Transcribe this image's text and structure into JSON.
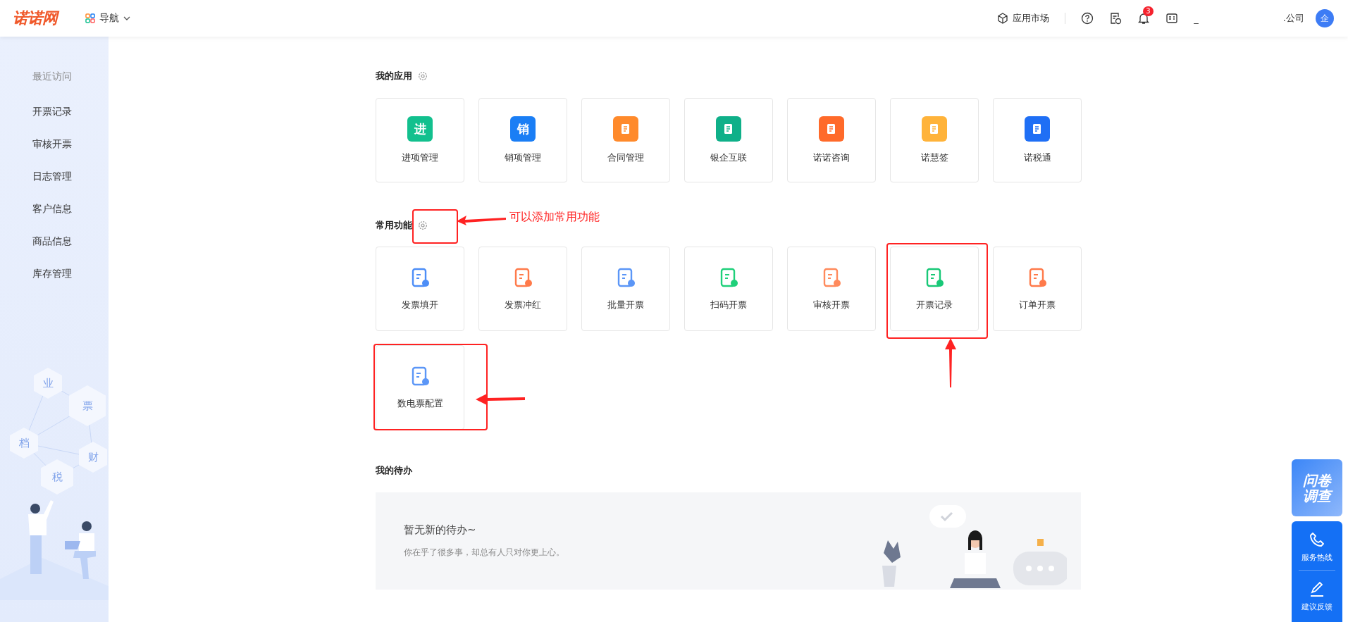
{
  "header": {
    "logo": "诺诺网",
    "nav": "导航",
    "market": "应用市场",
    "notifications": "3",
    "user": "_",
    "company": ".公司",
    "avatar": "企"
  },
  "sidebar": {
    "title": "最近访问",
    "items": [
      {
        "label": "开票记录"
      },
      {
        "label": "审核开票"
      },
      {
        "label": "日志管理"
      },
      {
        "label": "客户信息"
      },
      {
        "label": "商品信息"
      },
      {
        "label": "库存管理"
      }
    ],
    "hexagons": [
      "业",
      "票",
      "档",
      "财",
      "税"
    ]
  },
  "my_apps": {
    "title": "我的应用",
    "items": [
      {
        "label": "进项管理",
        "color": "#12c08e",
        "glyph": "进"
      },
      {
        "label": "销项管理",
        "color": "#1a7ef5",
        "glyph": "销"
      },
      {
        "label": "合同管理",
        "color": "#ff8a2b"
      },
      {
        "label": "银企互联",
        "color": "#0fb089"
      },
      {
        "label": "诺诺咨询",
        "color": "#ff6a2a"
      },
      {
        "label": "诺慧签",
        "color": "#ffb33a"
      },
      {
        "label": "诺税通",
        "color": "#1f6ff5"
      }
    ]
  },
  "common_functions": {
    "title": "常用功能",
    "annotation": "可以添加常用功能",
    "items": [
      {
        "label": "发票填开",
        "color": "#4d8ef7"
      },
      {
        "label": "发票冲红",
        "color": "#ff7a4a"
      },
      {
        "label": "批量开票",
        "color": "#5b96f7"
      },
      {
        "label": "扫码开票",
        "color": "#1fd07a"
      },
      {
        "label": "审核开票",
        "color": "#ff8a5c"
      },
      {
        "label": "开票记录",
        "color": "#18c877"
      },
      {
        "label": "订单开票",
        "color": "#ff7a4a"
      },
      {
        "label": "数电票配置",
        "color": "#5b96f7"
      }
    ]
  },
  "todo": {
    "title": "我的待办",
    "empty_title": "暂无新的待办~",
    "empty_text": "你在乎了很多事，却总有人只对你更上心。"
  },
  "float": {
    "survey": "问卷调查",
    "hotline": "服务热线",
    "feedback": "建议反馈"
  }
}
